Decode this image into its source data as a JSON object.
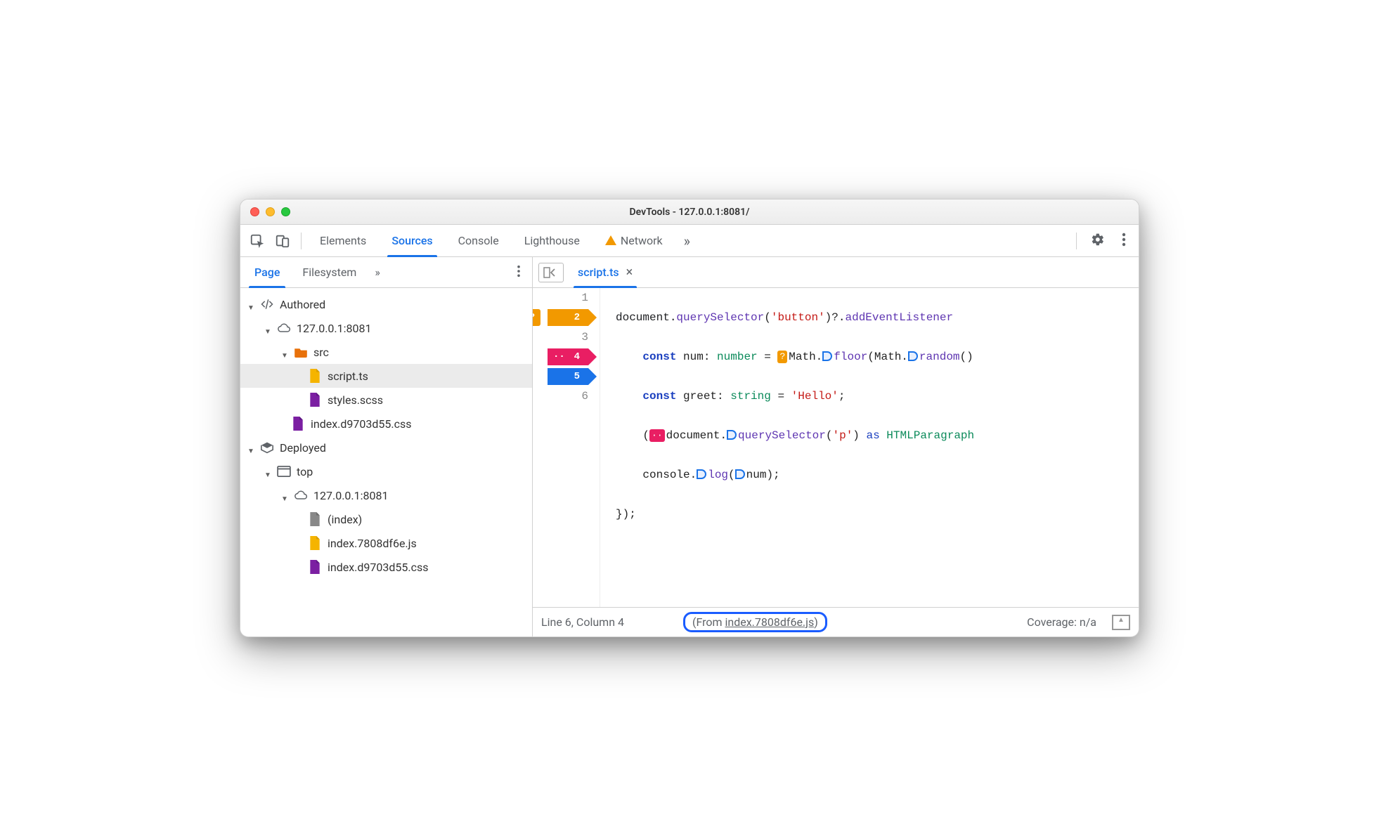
{
  "window": {
    "title": "DevTools - 127.0.0.1:8081/"
  },
  "toolbar_tabs": {
    "elements": "Elements",
    "sources": "Sources",
    "console": "Console",
    "lighthouse": "Lighthouse",
    "network": "Network"
  },
  "left_tabs": {
    "page": "Page",
    "filesystem": "Filesystem"
  },
  "tree": {
    "authored": "Authored",
    "host1": "127.0.0.1:8081",
    "src": "src",
    "script_ts": "script.ts",
    "styles_scss": "styles.scss",
    "index_css_auth": "index.d9703d55.css",
    "deployed": "Deployed",
    "top": "top",
    "host2": "127.0.0.1:8081",
    "index": "(index)",
    "index_js": "index.7808df6e.js",
    "index_css_dep": "index.d9703d55.css"
  },
  "file_tab": {
    "name": "script.ts"
  },
  "gutter": {
    "l1": "1",
    "l2": "2",
    "l3": "3",
    "l4": "4",
    "l5": "5",
    "l6": "6",
    "bp2_badge": "?",
    "bp4_badge": "··"
  },
  "code": {
    "l1_a": "document.",
    "l1_b": "querySelector",
    "l1_c": "(",
    "l1_d": "'button'",
    "l1_e": ")?.",
    "l1_f": "addEventListener",
    "l2_a": "const",
    "l2_b": " num: ",
    "l2_c": "number",
    "l2_d": " = ",
    "l2_pill": "?",
    "l2_e": "Math.",
    "l2_f": "floor",
    "l2_g": "(Math.",
    "l2_h": "random",
    "l2_i": "()",
    "l3_a": "const",
    "l3_b": " greet: ",
    "l3_c": "string",
    "l3_d": " = ",
    "l3_e": "'Hello'",
    "l3_f": ";",
    "l4_a": "(",
    "l4_pill": "··",
    "l4_b": "document.",
    "l4_c": "querySelector",
    "l4_d": "(",
    "l4_e": "'p'",
    "l4_f": ") ",
    "l4_g": "as",
    "l4_h": " HTMLParagraph",
    "l5_a": "console.",
    "l5_b": "log",
    "l5_c": "(",
    "l5_d": "num);",
    "l6_a": "});"
  },
  "status": {
    "pos": "Line 6, Column 4",
    "from_prefix": "(From ",
    "from_link": "index.7808df6e.js",
    "from_suffix": ")",
    "coverage": "Coverage: n/a"
  }
}
